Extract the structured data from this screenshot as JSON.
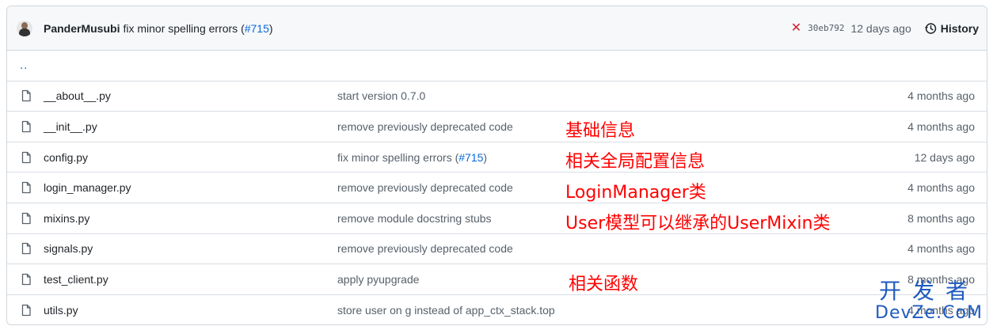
{
  "commit": {
    "author": "PanderMusubi",
    "message": "fix minor spelling errors (",
    "pr_link": "#715",
    "message_end": ")",
    "status_icon": "x-icon",
    "sha": "30eb792",
    "age": "12 days ago",
    "history_label": "History"
  },
  "parent_dir": "..",
  "files": [
    {
      "name": "__about__.py",
      "message": "start version 0.7.0",
      "link": "",
      "message_end": "",
      "age": "4 months ago"
    },
    {
      "name": "__init__.py",
      "message": "remove previously deprecated code",
      "link": "",
      "message_end": "",
      "age": "4 months ago"
    },
    {
      "name": "config.py",
      "message": "fix minor spelling errors (",
      "link": "#715",
      "message_end": ")",
      "age": "12 days ago"
    },
    {
      "name": "login_manager.py",
      "message": "remove previously deprecated code",
      "link": "",
      "message_end": "",
      "age": "4 months ago"
    },
    {
      "name": "mixins.py",
      "message": "remove module docstring stubs",
      "link": "",
      "message_end": "",
      "age": "8 months ago"
    },
    {
      "name": "signals.py",
      "message": "remove previously deprecated code",
      "link": "",
      "message_end": "",
      "age": "4 months ago"
    },
    {
      "name": "test_client.py",
      "message": "apply pyupgrade",
      "link": "",
      "message_end": "",
      "age": "8 months ago"
    },
    {
      "name": "utils.py",
      "message": "store user on g instead of app_ctx_stack.top",
      "link": "",
      "message_end": "",
      "age": "4 months ago"
    }
  ],
  "annotations": {
    "init": "基础信息",
    "config": "相关全局配置信息",
    "login_manager": "LoginManager类",
    "mixins": "User模型可以继承的UserMixin类",
    "test_client": "相关函数"
  },
  "watermark": {
    "line1": "开发者",
    "line2": "DevZe.CoM"
  },
  "colors": {
    "link": "#0969da",
    "annotation": "#ff0000",
    "fail": "#cf222e",
    "watermark": "#1f5bbf"
  }
}
